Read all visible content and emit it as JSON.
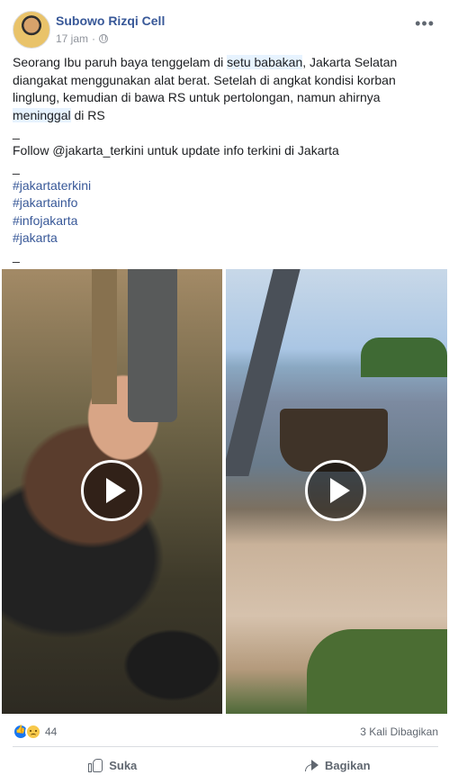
{
  "post": {
    "author": "Subowo Rizqi Cell",
    "time": "17 jam",
    "privacy_icon": "globe-icon",
    "text": {
      "p1_a": "Seorang Ibu paruh baya tenggelam di ",
      "p1_link1": "setu babakan",
      "p1_b": ", Jakarta Selatan diangakat menggunakan alat berat. Setelah di angkat kondisi korban linglung, kemudian di bawa RS untuk pertolongan, namun ahirnya ",
      "p1_link2": "meninggal",
      "p1_c": " di RS",
      "sep1": "_",
      "p2": "Follow @jakarta_terkini untuk update info terkini di Jakarta",
      "sep2": "_",
      "hashtags": [
        "#jakartaterkini",
        "#jakartainfo",
        "#infojakarta",
        "#jakarta"
      ],
      "sep3": "_"
    },
    "videos": [
      {
        "name": "video-1",
        "play_icon": "play-icon"
      },
      {
        "name": "video-2",
        "play_icon": "play-icon"
      }
    ],
    "reactions": {
      "icons": [
        "like-icon",
        "sad-icon"
      ],
      "count": "44"
    },
    "shares": "3 Kali Dibagikan",
    "actions": {
      "like_label": "Suka",
      "share_label": "Bagikan"
    }
  },
  "colors": {
    "link": "#385898",
    "highlight": "#e7f3ff",
    "secondary_text": "#90949c"
  }
}
